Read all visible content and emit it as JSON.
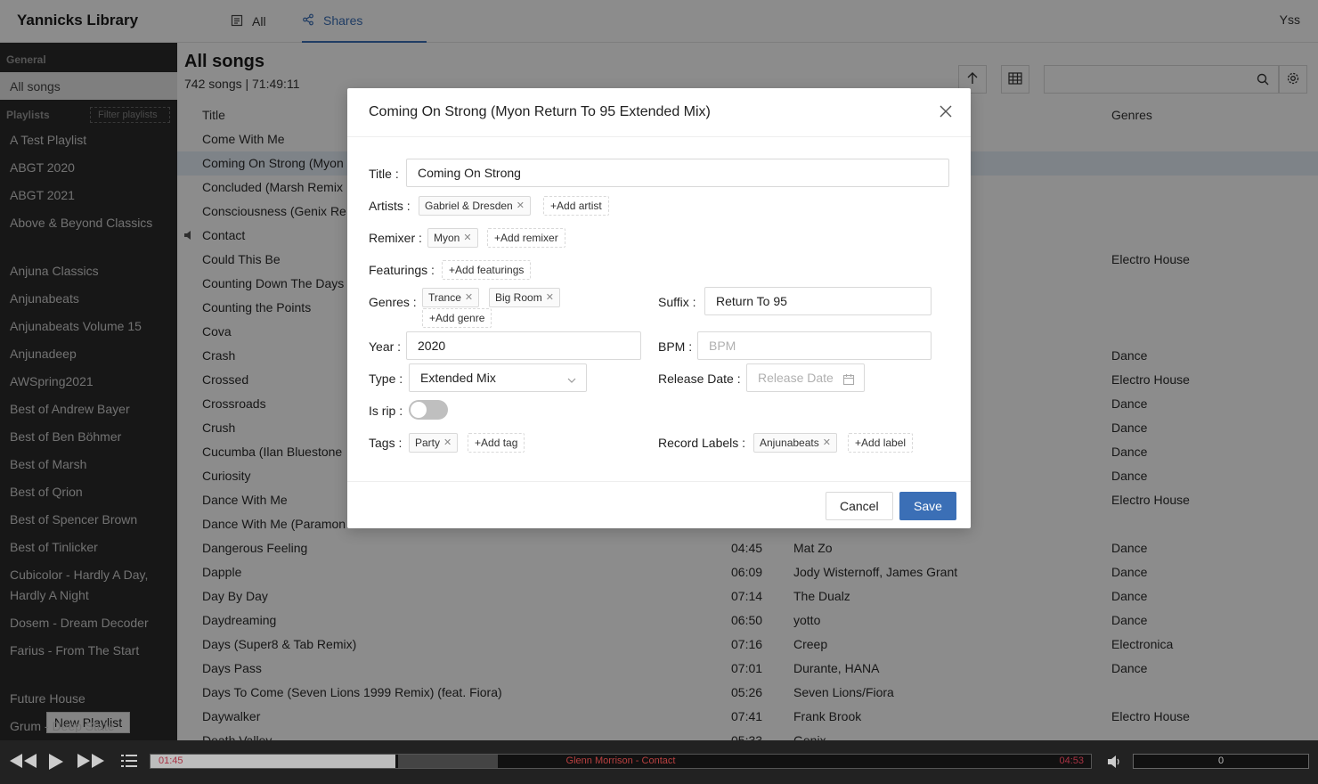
{
  "header": {
    "brand": "Yannicks Library",
    "tabs": [
      {
        "label": "All"
      },
      {
        "label": "Shares"
      }
    ],
    "user": "Yss"
  },
  "sidebar": {
    "general_title": "General",
    "all_songs": "All songs",
    "playlists_title": "Playlists",
    "filter_placeholder": "Filter playlists",
    "items": [
      "A Test Playlist",
      "ABGT 2020",
      "ABGT 2021",
      "Above & Beyond Classics",
      "Anjuna Classics",
      "Anjunabeats",
      "Anjunabeats Volume 15",
      "Anjunadeep",
      "AWSpring2021",
      "Best of Andrew Bayer",
      "Best of Ben Böhmer",
      "Best of Marsh",
      "Best of Qrion",
      "Best of Spencer Brown",
      "Best of Tinlicker",
      "Cubicolor - Hardly A Day, Hardly A Night",
      "Dosem - Dream Decoder",
      "Farius - From The Start",
      "Future House",
      "Grum - Deep State"
    ],
    "new_playlist": "New Playlist"
  },
  "main": {
    "title": "All songs",
    "subtitle": "742 songs | 71:49:11",
    "columns": {
      "title": "Title",
      "genres": "Genres"
    },
    "rows": [
      {
        "title": "Come With Me",
        "duration": "",
        "artist": "",
        "genre": ""
      },
      {
        "title": "Coming On Strong (Myon",
        "duration": "",
        "artist": "",
        "genre": ""
      },
      {
        "title": "Concluded (Marsh Remix",
        "duration": "",
        "artist": "",
        "genre": ""
      },
      {
        "title": "Consciousness (Genix Re",
        "duration": "",
        "artist": "",
        "genre": ""
      },
      {
        "title": "Contact",
        "duration": "",
        "artist": "",
        "genre": ""
      },
      {
        "title": "Could This Be",
        "duration": "",
        "artist": "",
        "genre": "Electro House"
      },
      {
        "title": "Counting Down The Days",
        "duration": "",
        "artist": "",
        "genre": ""
      },
      {
        "title": "Counting the Points",
        "duration": "",
        "artist": "",
        "genre": ""
      },
      {
        "title": "Cova",
        "duration": "",
        "artist": "",
        "genre": ""
      },
      {
        "title": "Crash",
        "duration": "",
        "artist": "",
        "genre": "Dance"
      },
      {
        "title": "Crossed",
        "duration": "",
        "artist": "",
        "genre": "Electro House"
      },
      {
        "title": "Crossroads",
        "duration": "",
        "artist": "",
        "genre": "Dance"
      },
      {
        "title": "Crush",
        "duration": "",
        "artist": "",
        "genre": "Dance"
      },
      {
        "title": "Cucumba (Ilan Bluestone",
        "duration": "",
        "artist": "",
        "genre": "Dance"
      },
      {
        "title": "Curiosity",
        "duration": "",
        "artist": "",
        "genre": "Dance"
      },
      {
        "title": "Dance With Me",
        "duration": "",
        "artist": "",
        "genre": "Electro House"
      },
      {
        "title": "Dance With Me (Paramon",
        "duration": "",
        "artist": "",
        "genre": ""
      },
      {
        "title": "Dangerous Feeling",
        "duration": "04:45",
        "artist": "Mat Zo",
        "genre": "Dance"
      },
      {
        "title": "Dapple",
        "duration": "06:09",
        "artist": "Jody Wisternoff, James Grant",
        "genre": "Dance"
      },
      {
        "title": "Day By Day",
        "duration": "07:14",
        "artist": "The Dualz",
        "genre": "Dance"
      },
      {
        "title": "Daydreaming",
        "duration": "06:50",
        "artist": "yotto",
        "genre": "Dance"
      },
      {
        "title": "Days (Super8 & Tab Remix)",
        "duration": "07:16",
        "artist": "Creep",
        "genre": "Electronica"
      },
      {
        "title": "Days Pass",
        "duration": "07:01",
        "artist": "Durante, HANA",
        "genre": "Dance"
      },
      {
        "title": "Days To Come (Seven Lions 1999 Remix) (feat. Fiora)",
        "duration": "05:26",
        "artist": "Seven Lions/Fiora",
        "genre": ""
      },
      {
        "title": "Daywalker",
        "duration": "07:41",
        "artist": "Frank Brook",
        "genre": "Electro House"
      },
      {
        "title": "Death Valley",
        "duration": "05:33",
        "artist": "Genix",
        "genre": ""
      }
    ]
  },
  "player": {
    "elapsed": "01:45",
    "track": "Glenn Morrison - Contact",
    "total": "04:53",
    "progress": 0.26,
    "volume": "0"
  },
  "modal": {
    "title": "Coming On Strong (Myon Return To 95 Extended Mix)",
    "labels": {
      "title": "Title",
      "artists": "Artists",
      "remixer": "Remixer",
      "featurings": "Featurings",
      "genres": "Genres",
      "suffix": "Suffix",
      "year": "Year",
      "bpm": "BPM",
      "type": "Type",
      "release_date": "Release Date",
      "is_rip": "Is rip",
      "tags": "Tags",
      "record_labels": "Record Labels"
    },
    "title_value": "Coming On Strong",
    "artists": [
      "Gabriel & Dresden"
    ],
    "add_artist": "Add artist",
    "remixers": [
      "Myon"
    ],
    "add_remixer": "Add remixer",
    "add_featurings": "Add featurings",
    "genres": [
      "Trance",
      "Big Room"
    ],
    "add_genre": "Add genre",
    "suffix_value": "Return To 95",
    "year_value": "2020",
    "bpm_placeholder": "BPM",
    "type_value": "Extended Mix",
    "release_date_placeholder": "Release Date",
    "is_rip": false,
    "tags": [
      "Party"
    ],
    "add_tag": "Add tag",
    "record_labels": [
      "Anjunabeats"
    ],
    "add_label": "Add label",
    "cancel": "Cancel",
    "save": "Save"
  }
}
